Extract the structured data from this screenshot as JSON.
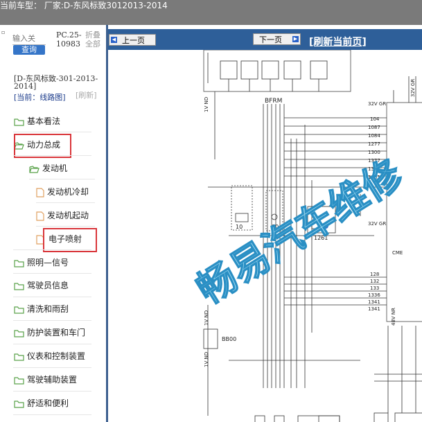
{
  "header": {
    "model_line": "当前车型： 厂家:D-东风标致3012013-2014"
  },
  "search": {
    "placeholder": "输入关",
    "button_label": "查询",
    "pc_label": "PC.25-",
    "pc_code": "10983",
    "fold_label": "折叠",
    "expand_label": "全部"
  },
  "sidebar": {
    "model": "[D-东风标致-301-2013-2014]",
    "current_prefix": "[当前：",
    "current_value": "线路图]",
    "refresh_label": "[刷新]",
    "items": [
      {
        "label": "基本看法",
        "icon": "folder-icon"
      },
      {
        "label": "动力总成",
        "icon": "folder-open-icon"
      },
      {
        "label": "发动机",
        "icon": "folder-open-icon"
      },
      {
        "label": "发动机冷却",
        "icon": "document-icon"
      },
      {
        "label": "发动机起动",
        "icon": "document-icon"
      },
      {
        "label": "电子喷射",
        "icon": "document-icon"
      },
      {
        "label": "照明—信号",
        "icon": "folder-icon"
      },
      {
        "label": "驾驶员信息",
        "icon": "folder-icon"
      },
      {
        "label": "清洗和雨刮",
        "icon": "folder-icon"
      },
      {
        "label": "防护装置和车门",
        "icon": "folder-icon"
      },
      {
        "label": "仪表和控制装置",
        "icon": "folder-icon"
      },
      {
        "label": "驾驶辅助装置",
        "icon": "folder-icon"
      },
      {
        "label": "舒适和便利",
        "icon": "folder-icon"
      }
    ]
  },
  "toolbar": {
    "prev_label": "上一页",
    "next_label": "下一页",
    "refresh_page_label": "[刷新当前页]"
  },
  "diagram": {
    "watermark": "畅易汽车维修",
    "labels": {
      "bfrm": "BFRM",
      "bb00": "BB00",
      "cme": "CME",
      "c1261": "1261",
      "v1": "1V ND",
      "v2": "1V ND",
      "v3": "1V ND",
      "v32a": "32V GR",
      "v32b": "32V GR",
      "v32c": "32V GR",
      "v48": "48V NR",
      "n10": "10",
      "n80": "80",
      "pins_top": [
        "104",
        "1087",
        "1084",
        "1277",
        "1300",
        "1377",
        "1377",
        "1281"
      ],
      "pins_mid": [
        "128",
        "132",
        "133",
        "1336",
        "1341",
        "1341"
      ]
    }
  }
}
